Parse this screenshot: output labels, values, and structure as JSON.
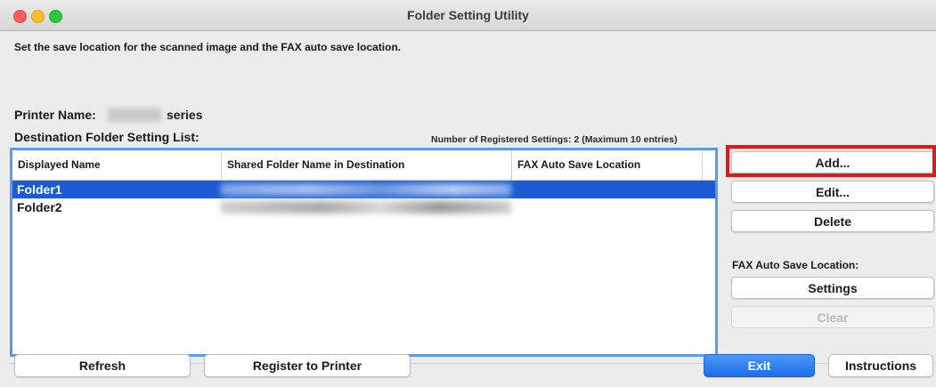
{
  "window": {
    "title": "Folder Setting Utility"
  },
  "intro_text": "Set the save location for the scanned image and the FAX auto save location.",
  "printer": {
    "label": "Printer Name:",
    "suffix": "series"
  },
  "list": {
    "label": "Destination Folder Setting List:",
    "count_text": "Number of Registered Settings: 2 (Maximum 10 entries)",
    "columns": [
      "Displayed Name",
      "Shared Folder Name in Destination",
      "FAX Auto Save Location"
    ],
    "rows": [
      {
        "name": "Folder1",
        "shared_folder": "",
        "fax_auto_save": "",
        "selected": true
      },
      {
        "name": "Folder2",
        "shared_folder": "",
        "fax_auto_save": "",
        "selected": false
      }
    ]
  },
  "side": {
    "add": "Add...",
    "edit": "Edit...",
    "delete": "Delete",
    "fax_label": "FAX Auto Save Location:",
    "settings": "Settings",
    "clear": "Clear"
  },
  "bottom": {
    "refresh": "Refresh",
    "register": "Register to Printer",
    "exit": "Exit",
    "instructions": "Instructions"
  },
  "colors": {
    "selection": "#1c5bd3",
    "focus_ring": "#5d9bea",
    "highlight": "#e51616",
    "primary_button": "#1a6fe8"
  }
}
